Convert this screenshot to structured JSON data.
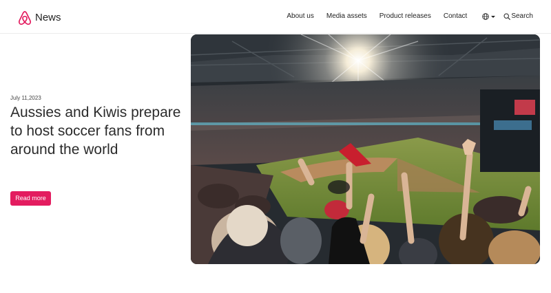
{
  "header": {
    "brand_name": "News",
    "nav": {
      "about": "About us",
      "media": "Media assets",
      "products": "Product releases",
      "contact": "Contact"
    },
    "language_icon": "globe-icon",
    "search_label": "Search",
    "search_icon": "search-icon"
  },
  "hero": {
    "date": "July 11,2023",
    "headline": "Aussies and Kiwis prepare to host soccer fans from around the world",
    "button_label": "Read more",
    "image_subject": "stadium crowd photo"
  },
  "colors": {
    "accent": "#e31c5f",
    "logo": "#e31c5f",
    "text": "#222222"
  }
}
